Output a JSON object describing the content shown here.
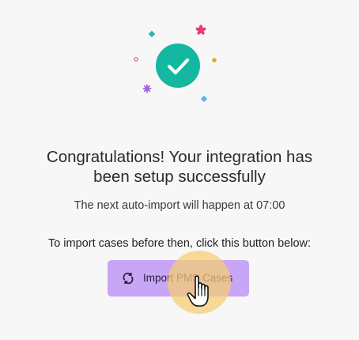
{
  "success": {
    "icon": "checkmark-icon",
    "circle_color": "#14b8a0"
  },
  "confetti_colors": {
    "pink": "#e83c7a",
    "teal": "#2ab7b0",
    "orange": "#f0a030",
    "purple": "#a35be0",
    "blue": "#57b8e6"
  },
  "message": {
    "heading_line1": "Congratulations! Your integration has",
    "heading_line2": "been setup successfully",
    "next_import": "The next auto-import will happen at 07:00",
    "instruction": "To import cases before then, click this button below:"
  },
  "import_button": {
    "label": "Import PMS Cases",
    "icon": "refresh-icon",
    "color": "#c7a6f5"
  },
  "cursor": {
    "icon": "hand-pointer-icon",
    "highlight_color": "#f7cd70"
  }
}
